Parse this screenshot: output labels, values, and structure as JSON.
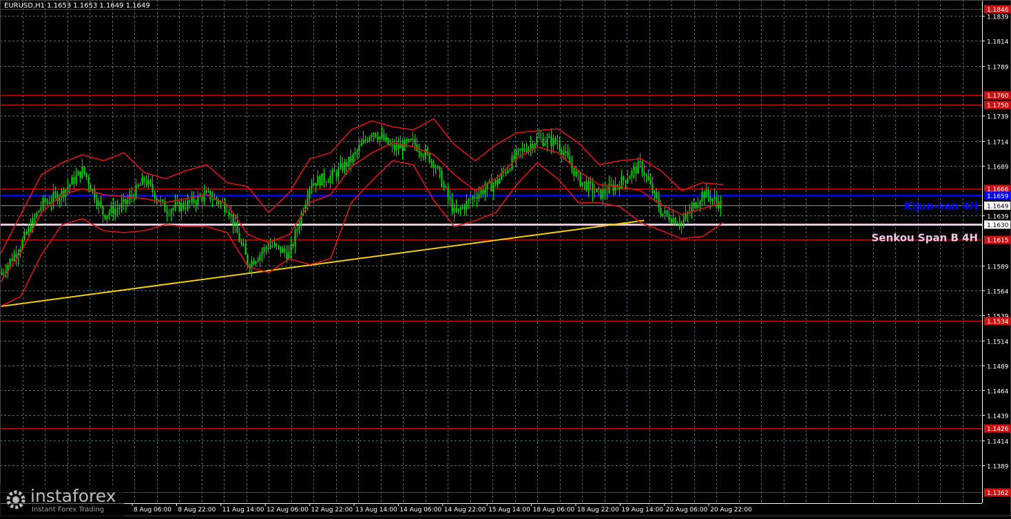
{
  "header": {
    "symbol_text": "EURUSD,H1  1.1653 1.1653 1.1649 1.1649"
  },
  "logo": {
    "name": "instaforex",
    "tagline": "Instant Forex Trading"
  },
  "colors": {
    "background": "#000000",
    "grid": "#5a6e74",
    "candles": "#00e000",
    "bands": "#e01414",
    "trendline": "#f5d000",
    "kijun": "#0000ff",
    "senkou": "#f0c8e6",
    "levels": "#d01010",
    "axis_text": "#ffffff"
  },
  "chart_data": {
    "type": "line",
    "title": "EURUSD,H1",
    "ohlc_readout": [
      "1.1653",
      "1.1653",
      "1.1649",
      "1.1649"
    ],
    "grid": true,
    "y_axis_side": "right",
    "ylim": [
      1.1351,
      1.1855
    ],
    "y_ticks": [
      "1.1839",
      "1.1814",
      "1.1789",
      "1.1739",
      "1.1714",
      "1.1689",
      "1.1639",
      "1.1589",
      "1.1564",
      "1.1539",
      "1.1514",
      "1.1489",
      "1.1464",
      "1.1439",
      "1.1414",
      "1.1389"
    ],
    "x_labels": [
      "8 Aug 06:00",
      "8 Aug 22:00",
      "11 Aug 14:00",
      "12 Aug 06:00",
      "12 Aug 22:00",
      "13 Aug 14:00",
      "14 Aug 06:00",
      "14 Aug 22:00",
      "15 Aug 14:00",
      "18 Aug 06:00",
      "18 Aug 22:00",
      "19 Aug 14:00",
      "20 Aug 06:00",
      "20 Aug 22:00"
    ],
    "horizontal_levels": [
      {
        "value": 1.1846,
        "label": "1.1846",
        "color": "#d01010"
      },
      {
        "value": 1.176,
        "label": "1.1760",
        "color": "#d01010"
      },
      {
        "value": 1.175,
        "label": "1.1750",
        "color": "#d01010"
      },
      {
        "value": 1.1666,
        "label": "1.1666",
        "color": "#d01010"
      },
      {
        "value": 1.1615,
        "label": "1.1615",
        "color": "#d01010"
      },
      {
        "value": 1.1534,
        "label": "1.1534",
        "color": "#d01010"
      },
      {
        "value": 1.1426,
        "label": "1.1426",
        "color": "#d01010"
      },
      {
        "value": 1.1362,
        "label": "1.1362",
        "color": "#d01010"
      }
    ],
    "indicator_lines": [
      {
        "name": "Kijun-sen 4H",
        "value": 1.1659,
        "label": "1.1659",
        "color": "#0000ff"
      },
      {
        "name": "Senkou Span B 4H",
        "value": 1.163,
        "label": "1.1630",
        "color": "#f0c8e6"
      }
    ],
    "current_price": {
      "value": 1.1649,
      "label": "1.1649"
    },
    "trendline": {
      "x": [
        0,
        1400
      ],
      "y": [
        1.1548,
        1.1677
      ]
    },
    "price": {
      "x": [
        0,
        30,
        60,
        90,
        120,
        150,
        180,
        210,
        240,
        270,
        300,
        330,
        360,
        390,
        420,
        450,
        480,
        510,
        540,
        570,
        600,
        630,
        660,
        690,
        720,
        750,
        780,
        810,
        840,
        870,
        900,
        930,
        960,
        990,
        1020,
        1050
      ],
      "y": [
        1.158,
        1.161,
        1.165,
        1.1662,
        1.1685,
        1.164,
        1.165,
        1.1675,
        1.1645,
        1.165,
        1.166,
        1.1648,
        1.159,
        1.161,
        1.16,
        1.1672,
        1.1678,
        1.1695,
        1.1725,
        1.1706,
        1.1712,
        1.1692,
        1.164,
        1.166,
        1.1672,
        1.17,
        1.1716,
        1.1712,
        1.1675,
        1.166,
        1.1672,
        1.169,
        1.1642,
        1.1632,
        1.1662,
        1.1649
      ]
    },
    "upper_band": {
      "x": [
        0,
        30,
        60,
        90,
        120,
        150,
        180,
        210,
        240,
        270,
        300,
        330,
        360,
        390,
        420,
        450,
        480,
        510,
        540,
        570,
        600,
        630,
        660,
        690,
        720,
        750,
        780,
        810,
        840,
        870,
        900,
        930,
        960,
        990,
        1020,
        1050
      ],
      "y": [
        1.16,
        1.164,
        1.168,
        1.1692,
        1.17,
        1.1694,
        1.1702,
        1.1682,
        1.1676,
        1.1684,
        1.169,
        1.1672,
        1.1668,
        1.1642,
        1.1662,
        1.1696,
        1.1702,
        1.1725,
        1.1734,
        1.1728,
        1.1725,
        1.1736,
        1.171,
        1.1694,
        1.171,
        1.1722,
        1.1724,
        1.1726,
        1.1712,
        1.169,
        1.1694,
        1.1696,
        1.1684,
        1.1664,
        1.1672,
        1.167
      ]
    },
    "middle_line": {
      "x": [
        0,
        30,
        60,
        90,
        120,
        150,
        180,
        210,
        240,
        270,
        300,
        330,
        360,
        390,
        420,
        450,
        480,
        510,
        540,
        570,
        600,
        630,
        660,
        690,
        720,
        750,
        780,
        810,
        840,
        870,
        900,
        930,
        960,
        990,
        1020,
        1050
      ],
      "y": [
        1.1572,
        1.1602,
        1.1642,
        1.166,
        1.1666,
        1.166,
        1.1658,
        1.1656,
        1.1652,
        1.1656,
        1.166,
        1.165,
        1.162,
        1.1612,
        1.162,
        1.1652,
        1.166,
        1.1688,
        1.1702,
        1.1712,
        1.1708,
        1.17,
        1.168,
        1.1664,
        1.1676,
        1.1696,
        1.1708,
        1.1702,
        1.1684,
        1.167,
        1.1668,
        1.1664,
        1.165,
        1.164,
        1.1646,
        1.1652
      ]
    },
    "lower_band": {
      "x": [
        0,
        30,
        60,
        90,
        120,
        150,
        180,
        210,
        240,
        270,
        300,
        330,
        360,
        390,
        420,
        450,
        480,
        510,
        540,
        570,
        600,
        630,
        660,
        690,
        720,
        750,
        780,
        810,
        840,
        870,
        900,
        930,
        960,
        990,
        1020,
        1050
      ],
      "y": [
        1.1548,
        1.1558,
        1.16,
        1.163,
        1.1636,
        1.1624,
        1.1622,
        1.1624,
        1.163,
        1.1628,
        1.1628,
        1.1622,
        1.1588,
        1.1582,
        1.1596,
        1.159,
        1.1596,
        1.1652,
        1.1674,
        1.1694,
        1.169,
        1.1654,
        1.1628,
        1.1634,
        1.1642,
        1.167,
        1.1692,
        1.1676,
        1.1652,
        1.1652,
        1.1648,
        1.1632,
        1.1624,
        1.1616,
        1.1618,
        1.1632
      ]
    }
  }
}
